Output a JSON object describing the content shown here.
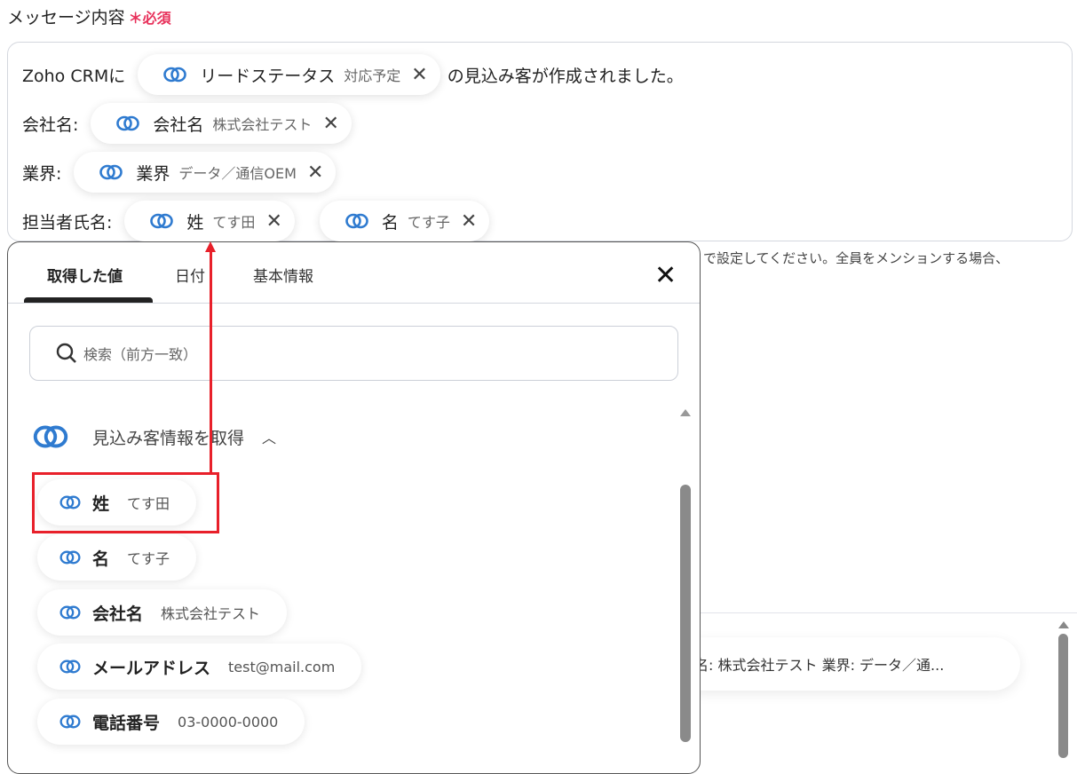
{
  "field": {
    "label": "メッセージ内容",
    "required_mark": "＊",
    "required": "必須"
  },
  "editor": {
    "line1_prefix": "Zoho CRMに",
    "line1_suffix": "の見込み客が作成されました。",
    "line2_label": "会社名:",
    "line3_label": "業界:",
    "line4_label": "担当者氏名:",
    "chips": [
      {
        "key": "リードステータス",
        "value": "対応予定"
      },
      {
        "key": "会社名",
        "value": "株式会社テスト"
      },
      {
        "key": "業界",
        "value": "データ／通信OEM"
      },
      {
        "key": "姓",
        "value": "てす田"
      },
      {
        "key": "名",
        "value": "てす子"
      }
    ]
  },
  "hint": "で設定してください。全員をメンションする場合、",
  "background_chip": "名: 株式会社テスト 業界: データ／通...",
  "popup": {
    "tabs": [
      "取得した値",
      "日付",
      "基本情報"
    ],
    "search_placeholder": "検索（前方一致）",
    "group": "見込み客情報を取得",
    "items": [
      {
        "key": "姓",
        "value": "てす田"
      },
      {
        "key": "名",
        "value": "てす子"
      },
      {
        "key": "会社名",
        "value": "株式会社テスト"
      },
      {
        "key": "メールアドレス",
        "value": "test@mail.com"
      },
      {
        "key": "電話番号",
        "value": "03-0000-0000"
      }
    ]
  },
  "colors": {
    "accent": "#e8315b",
    "zoho_icon": "#2f7bd0",
    "annotation": "#e8202a"
  }
}
